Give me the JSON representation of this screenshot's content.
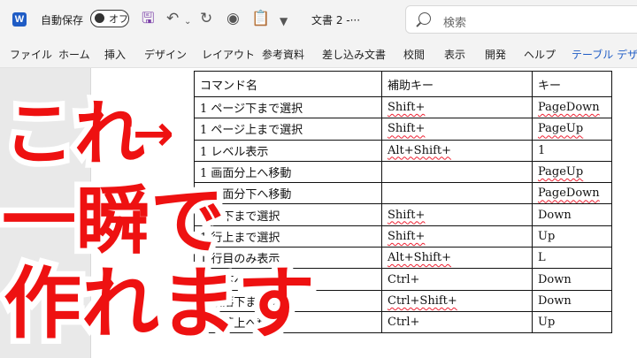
{
  "titlebar": {
    "autosave_label": "自動保存",
    "toggle_text": "オフ",
    "doc_title": "文書 2 -···",
    "search_placeholder": "検索"
  },
  "ribbon": {
    "tabs": [
      "ファイル",
      "ホーム",
      "挿入",
      "デザイン",
      "レイアウト",
      "参考資料",
      "差し込み文書",
      "校閲",
      "表示",
      "開発",
      "ヘルプ",
      "テーブル デザイン"
    ],
    "active_tab": "テーブル デザイン"
  },
  "colors": {
    "accent": "#1f5cc5",
    "overlay_text": "#ee1111",
    "overlay_outline": "#ffffff"
  },
  "table": {
    "headers": [
      "コマンド名",
      "補助キー",
      "キー"
    ],
    "rows": [
      [
        "1 ページ下まで選択",
        "Shift+",
        "PageDown"
      ],
      [
        "1 ページ上まで選択",
        "Shift+",
        "PageUp"
      ],
      [
        "1 レベル表示",
        "Alt+Shift+",
        "1"
      ],
      [
        "1 画面分上へ移動",
        "",
        "PageUp"
      ],
      [
        "1 画面分下へ移動",
        "",
        "PageDown"
      ],
      [
        "1 行下まで選択",
        "Shift+",
        "Down"
      ],
      [
        "1 行上まで選択",
        "Shift+",
        "Up"
      ],
      [
        "1 行目のみ表示",
        "Alt+Shift+",
        "L"
      ],
      [
        "1 行下へ移動",
        "Ctrl+",
        "Down"
      ],
      [
        "1 段落下まで選択",
        "Ctrl+Shift+",
        "Down"
      ],
      [
        "1 段落上へ移動",
        "Ctrl+",
        "Up"
      ]
    ]
  },
  "overlay": {
    "line1": "これ",
    "arrow": "→",
    "line2": "一瞬で",
    "line3": "作れます"
  }
}
